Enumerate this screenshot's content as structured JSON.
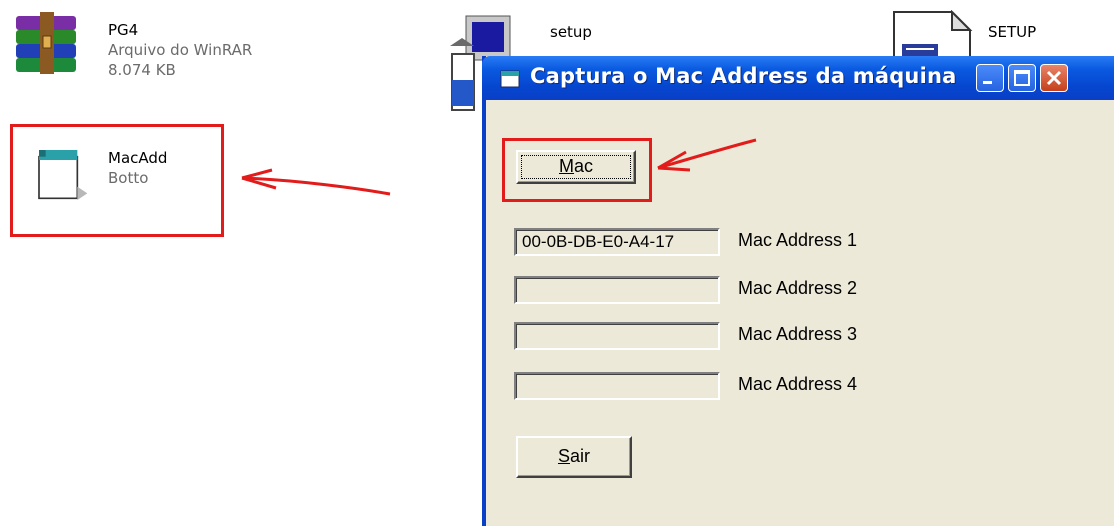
{
  "desktop": {
    "items": [
      {
        "name": "PG4",
        "type": "Arquivo do WinRAR",
        "size": "8.074 KB"
      },
      {
        "name": "MacAdd",
        "type": "Botto"
      },
      {
        "name": "setup"
      },
      {
        "name": "SETUP"
      }
    ]
  },
  "dialog": {
    "title": "Captura o Mac Address da máquina",
    "mac_button": {
      "accel": "M",
      "rest": "ac"
    },
    "fields": [
      {
        "value": "00-0B-DB-E0-A4-17",
        "label": "Mac Address 1"
      },
      {
        "value": "",
        "label": "Mac Address 2"
      },
      {
        "value": "",
        "label": "Mac Address 3"
      },
      {
        "value": "",
        "label": "Mac Address 4"
      }
    ],
    "sair_button": {
      "accel": "S",
      "rest": "air"
    }
  },
  "colors": {
    "highlight": "#e21b1b",
    "titlebar": "#0a5ae0",
    "dialog_bg": "#ece9d8"
  },
  "icons": {
    "pg4": "winrar-archive-icon",
    "macadd": "application-window-icon",
    "setup1": "installer-computer-icon",
    "setup2": "setup-config-file-icon"
  }
}
